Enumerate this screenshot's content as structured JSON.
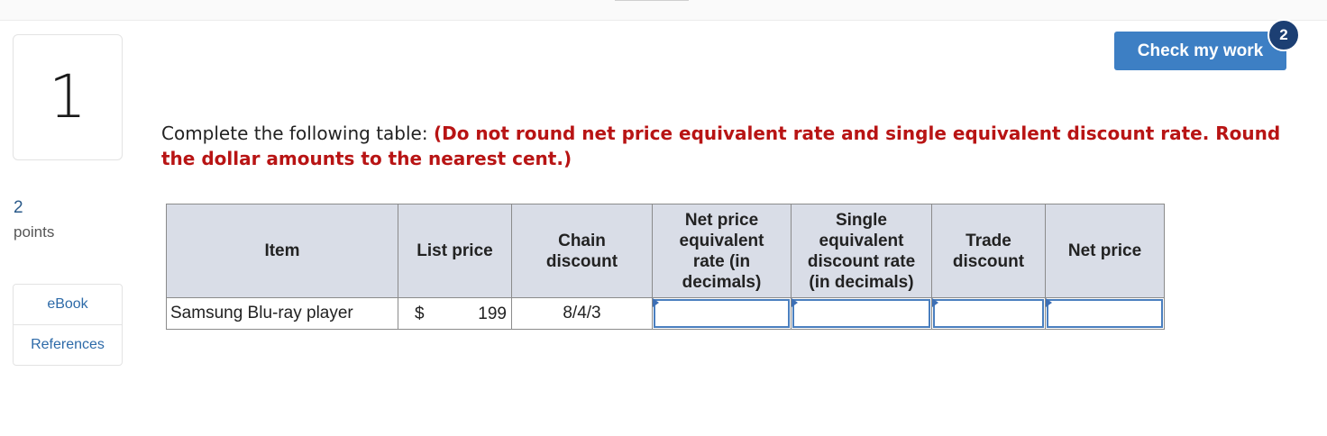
{
  "question": {
    "number": "1",
    "points_value": "2",
    "points_label": "points"
  },
  "sidebar": {
    "links": [
      {
        "label": "eBook"
      },
      {
        "label": "References"
      }
    ]
  },
  "header": {
    "check_button_label": "Check my work",
    "attempts_badge": "2"
  },
  "instructions": {
    "prefix": "Complete the following table: ",
    "emphasis": "(Do not round net price equivalent rate and single equivalent discount rate. Round the dollar amounts to the nearest cent.)"
  },
  "table": {
    "headers": [
      "Item",
      "List price",
      "Chain discount",
      "Net price equivalent rate (in decimals)",
      "Single equivalent discount rate (in decimals)",
      "Trade discount",
      "Net price"
    ],
    "row": {
      "item": "Samsung Blu-ray player",
      "currency": "$",
      "list_price": "199",
      "chain_discount": "8/4/3",
      "net_price_equivalent_rate": "",
      "single_equivalent_discount_rate": "",
      "trade_discount": "",
      "net_price": ""
    }
  },
  "colors": {
    "accent_button": "#3d7fc4",
    "badge": "#1c3f73",
    "emphasis_text": "#b81414",
    "header_fill": "#d9dde7"
  }
}
